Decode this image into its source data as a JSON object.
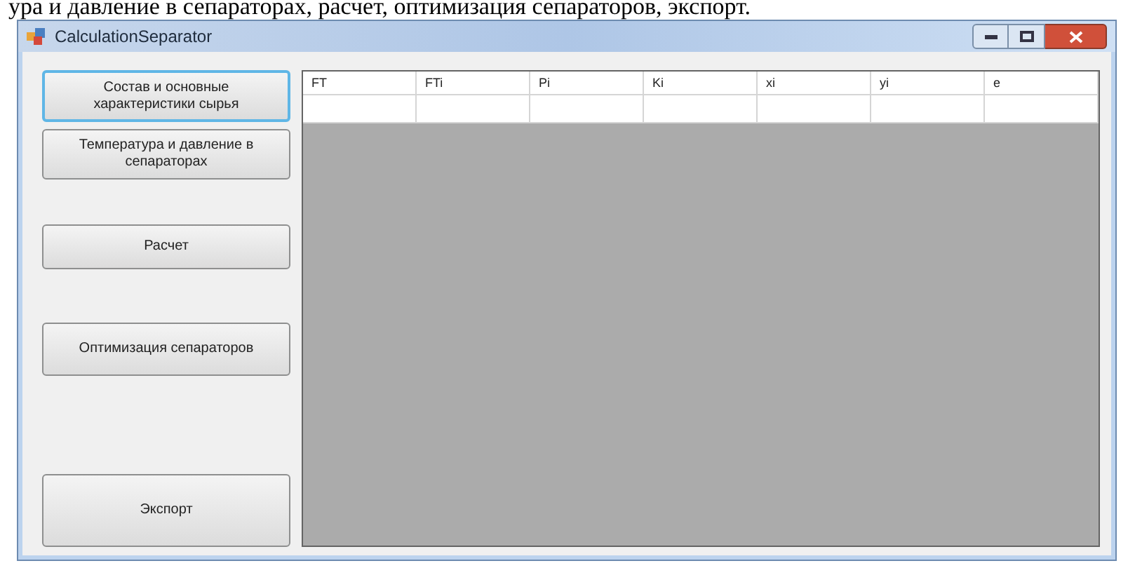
{
  "document_text": "ура и давление в сепараторах, расчет, оптимизация сепараторов, экспорт.",
  "window": {
    "title": "CalculationSeparator"
  },
  "buttons": [
    {
      "label": "Состав и основные характеристики сырья",
      "focused": true
    },
    {
      "label": "Температура и давление в сепараторах",
      "focused": false
    },
    {
      "label": "Расчет",
      "focused": false
    },
    {
      "label": "Оптимизация сепараторов",
      "focused": false
    },
    {
      "label": "Экспорт",
      "focused": false
    }
  ],
  "table": {
    "columns": [
      "FT",
      "FTi",
      "Pi",
      "Ki",
      "xi",
      "yi",
      "e"
    ]
  }
}
